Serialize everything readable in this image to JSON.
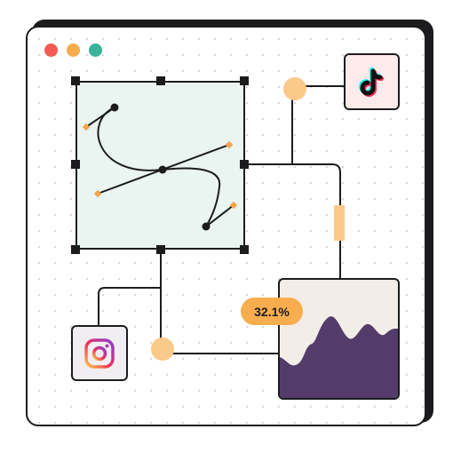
{
  "window": {
    "controls": [
      "close",
      "minimize",
      "maximize"
    ],
    "control_colors": {
      "close": "#f25a53",
      "minimize": "#f5ad4d",
      "maximize": "#39b39a"
    }
  },
  "editor": {
    "tool": "bezier-pen",
    "canvas_color": "#eaf5f2"
  },
  "connectors": {
    "node_color": "#fbc98a"
  },
  "apps": [
    {
      "name": "tiktok",
      "icon": "tiktok-icon"
    },
    {
      "name": "instagram",
      "icon": "instagram-icon"
    }
  ],
  "stats": {
    "percent": "32.1%",
    "badge_color": "#f8ad4f",
    "area_color": "#533c6a",
    "chart_background": "#f2ede7"
  }
}
